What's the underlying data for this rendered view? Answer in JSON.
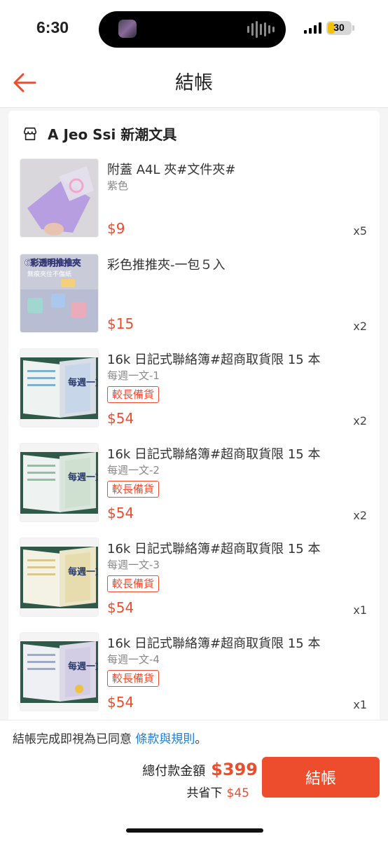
{
  "status_bar": {
    "time": "6:30",
    "battery": "30"
  },
  "header": {
    "title": "結帳",
    "back_icon": "arrow-left-icon",
    "accent": "#ee4d2d"
  },
  "shop": {
    "name": "A Jeo Ssi 新潮文具",
    "icon": "store-icon"
  },
  "items": [
    {
      "name": "附蓋 A4L 夾#文件夾#",
      "variant": "紫色",
      "badge": "",
      "price": "$9",
      "qty": "x5"
    },
    {
      "name": "彩色推推夾-一包５入",
      "variant": "",
      "badge": "",
      "price": "$15",
      "qty": "x2",
      "thumb_text": "6彩透明推推夾",
      "thumb_subtext": "無痕夾住不傷紙"
    },
    {
      "name": "16k 日記式聯絡簿#超商取貨限 15 本",
      "variant": "每週一文-1",
      "badge": "較長備貨",
      "price": "$54",
      "qty": "x2",
      "thumb_text": "每週一文"
    },
    {
      "name": "16k 日記式聯絡簿#超商取貨限 15 本",
      "variant": "每週一文-2",
      "badge": "較長備貨",
      "price": "$54",
      "qty": "x2",
      "thumb_text": "每週一文"
    },
    {
      "name": "16k 日記式聯絡簿#超商取貨限 15 本",
      "variant": "每週一文-3",
      "badge": "較長備貨",
      "price": "$54",
      "qty": "x1",
      "thumb_text": "每週一文"
    },
    {
      "name": "16k 日記式聯絡簿#超商取貨限 15 本",
      "variant": "每週一文-4",
      "badge": "較長備貨",
      "price": "$54",
      "qty": "x1",
      "thumb_text": "每週一文"
    }
  ],
  "footer": {
    "terms_text": "結帳完成即視為已同意",
    "terms_link": "條款與規則",
    "terms_end": "。",
    "total_label": "總付款金額",
    "total_value": "$399",
    "saved_label": "共省下",
    "saved_value": "$45",
    "checkout_label": "結帳",
    "link_color": "#1a7fd4"
  }
}
